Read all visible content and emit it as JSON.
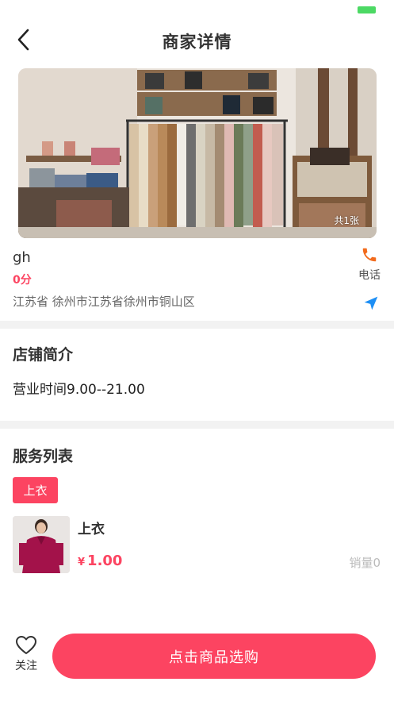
{
  "header": {
    "title": "商家详情",
    "back_icon": "chevron-left-icon"
  },
  "banner": {
    "photo_count": "共1张"
  },
  "shop": {
    "name": "gh",
    "score": "0分",
    "phone_label": "电话",
    "phone_icon": "phone-icon",
    "address": "江苏省 徐州市江苏省徐州市铜山区",
    "navigate_icon": "location-arrow-icon"
  },
  "intro": {
    "title": "店铺简介",
    "text": "营业时间9.00--21.00"
  },
  "services": {
    "title": "服务列表",
    "category_tag": "上衣",
    "items": [
      {
        "name": "上衣",
        "currency": "¥",
        "price": "1.00",
        "sales": "销量0"
      }
    ]
  },
  "bottom_bar": {
    "follow_label": "关注",
    "follow_icon": "heart-outline-icon",
    "cta_label": "点击商品选购"
  },
  "colors": {
    "accent": "#fc4461",
    "phone_icon": "#f26b1d",
    "navigate_icon": "#1d8ff5",
    "divider": "#f2f2f2",
    "battery": "#4cd964"
  }
}
